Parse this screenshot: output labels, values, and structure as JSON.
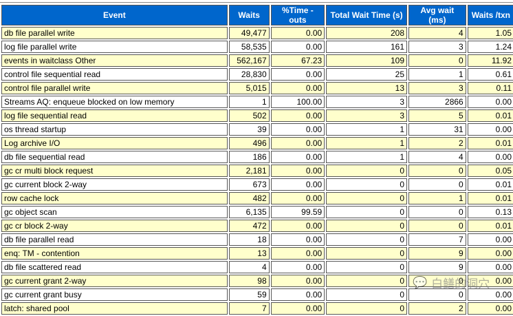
{
  "columns": [
    "Event",
    "Waits",
    "%Time -outs",
    "Total Wait Time (s)",
    "Avg wait (ms)",
    "Waits /txn"
  ],
  "rows": [
    [
      "db file parallel write",
      "49,477",
      "0.00",
      "208",
      "4",
      "1.05"
    ],
    [
      "log file parallel write",
      "58,535",
      "0.00",
      "161",
      "3",
      "1.24"
    ],
    [
      "events in waitclass Other",
      "562,167",
      "67.23",
      "109",
      "0",
      "11.92"
    ],
    [
      "control file sequential read",
      "28,830",
      "0.00",
      "25",
      "1",
      "0.61"
    ],
    [
      "control file parallel write",
      "5,015",
      "0.00",
      "13",
      "3",
      "0.11"
    ],
    [
      "Streams AQ: enqueue blocked on low memory",
      "1",
      "100.00",
      "3",
      "2866",
      "0.00"
    ],
    [
      "log file sequential read",
      "502",
      "0.00",
      "3",
      "5",
      "0.01"
    ],
    [
      "os thread startup",
      "39",
      "0.00",
      "1",
      "31",
      "0.00"
    ],
    [
      "Log archive I/O",
      "496",
      "0.00",
      "1",
      "2",
      "0.01"
    ],
    [
      "db file sequential read",
      "186",
      "0.00",
      "1",
      "4",
      "0.00"
    ],
    [
      "gc cr multi block request",
      "2,181",
      "0.00",
      "0",
      "0",
      "0.05"
    ],
    [
      "gc current block 2-way",
      "673",
      "0.00",
      "0",
      "0",
      "0.01"
    ],
    [
      "row cache lock",
      "482",
      "0.00",
      "0",
      "1",
      "0.01"
    ],
    [
      "gc object scan",
      "6,135",
      "99.59",
      "0",
      "0",
      "0.13"
    ],
    [
      "gc cr block 2-way",
      "472",
      "0.00",
      "0",
      "0",
      "0.01"
    ],
    [
      "db file parallel read",
      "18",
      "0.00",
      "0",
      "7",
      "0.00"
    ],
    [
      "enq: TM - contention",
      "13",
      "0.00",
      "0",
      "9",
      "0.00"
    ],
    [
      "db file scattered read",
      "4",
      "0.00",
      "0",
      "9",
      "0.00"
    ],
    [
      "gc current grant 2-way",
      "98",
      "0.00",
      "0",
      "0",
      "0.00"
    ],
    [
      "gc current grant busy",
      "59",
      "0.00",
      "0",
      "0",
      "0.00"
    ],
    [
      "latch: shared pool",
      "7",
      "0.00",
      "0",
      "2",
      "0.00"
    ]
  ],
  "watermark": "白鳝的洞穴"
}
